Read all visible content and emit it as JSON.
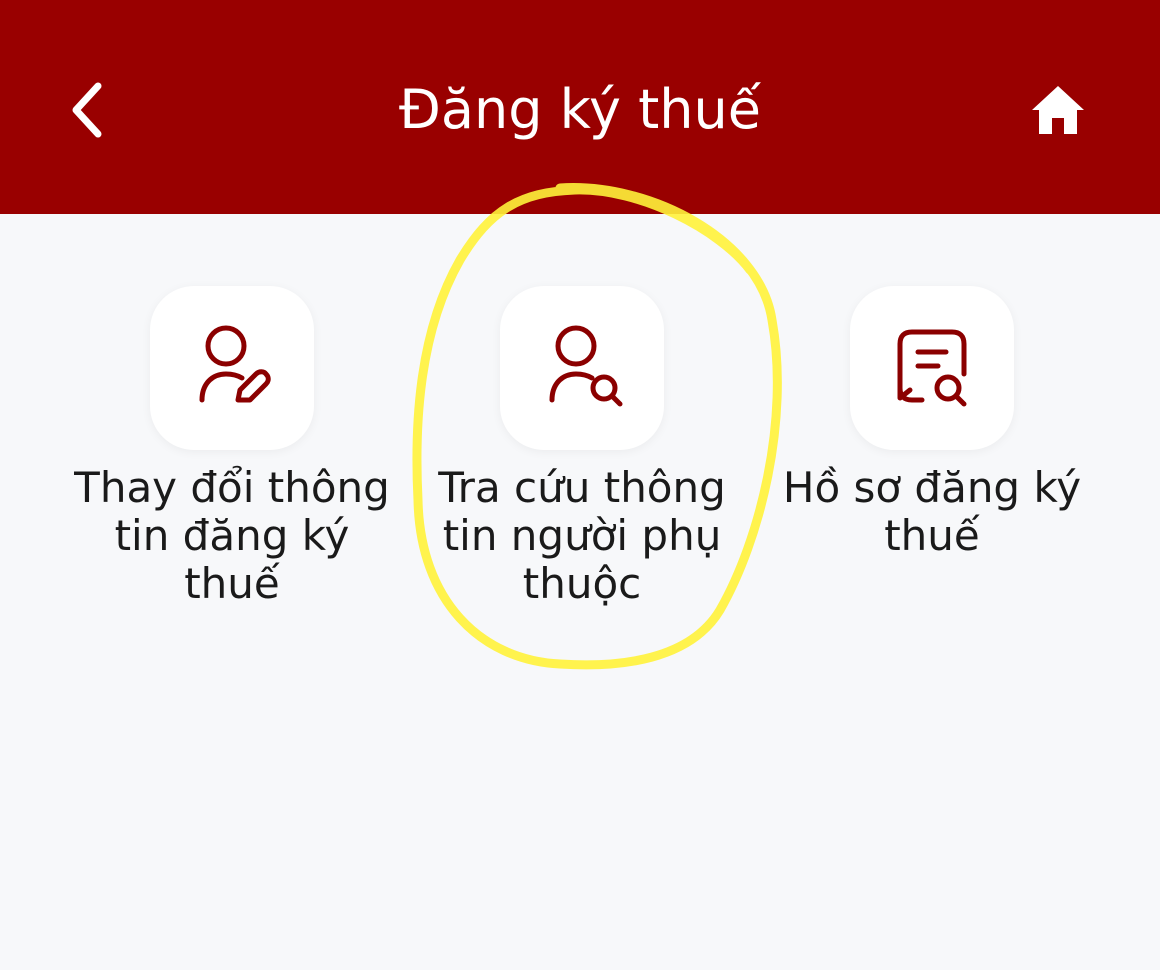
{
  "header": {
    "title": "Đăng ký thuế",
    "back_icon": "chevron-left-icon",
    "home_icon": "home-icon",
    "background_color": "#990000"
  },
  "tiles": [
    {
      "label": "Thay đổi thông tin đăng ký thuế",
      "icon": "user-edit-icon"
    },
    {
      "label": "Tra cứu thông tin người phụ thuộc",
      "icon": "user-search-icon"
    },
    {
      "label": "Hồ sơ đăng ký thuế",
      "icon": "document-search-icon"
    }
  ],
  "accent_color": "#8b0000",
  "highlight_color": "#fff23a"
}
